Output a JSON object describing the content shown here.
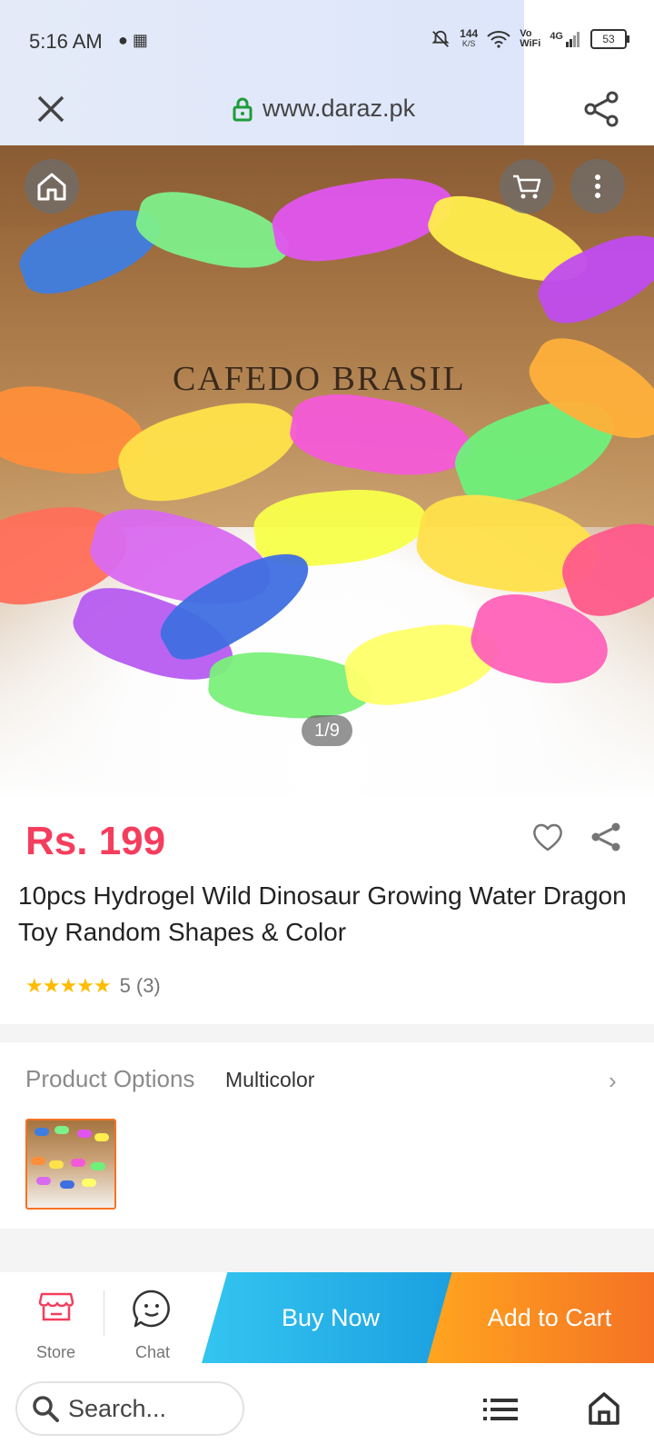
{
  "status_bar": {
    "time": "5:16 AM",
    "net_speed_value": "144",
    "net_speed_unit": "K/S",
    "volte_top": "Vo",
    "volte_bottom": "WiFi",
    "network": "4G",
    "battery": "53"
  },
  "browser": {
    "url": "www.daraz.pk"
  },
  "gallery": {
    "counter": "1/9",
    "crate_text": "CAFEDO BRASIL"
  },
  "product": {
    "price": "Rs. 199",
    "title": "10pcs Hydrogel Wild Dinosaur Growing Water Dragon Toy Random Shapes & Color",
    "rating_stars": "★★★★★",
    "rating_value": "5",
    "rating_count": "(3)"
  },
  "options": {
    "label": "Product Options",
    "value": "Multicolor",
    "chevron": "›"
  },
  "action_bar": {
    "store_label": "Store",
    "chat_label": "Chat",
    "buy_now": "Buy Now",
    "add_to_cart": "Add to Cart"
  },
  "bottom_bar": {
    "search_placeholder": "Search..."
  },
  "colors": {
    "price": "#f53d5d",
    "buy_now": "#1a9fe0",
    "add_to_cart": "#f57224",
    "stars": "#fdbc00"
  }
}
